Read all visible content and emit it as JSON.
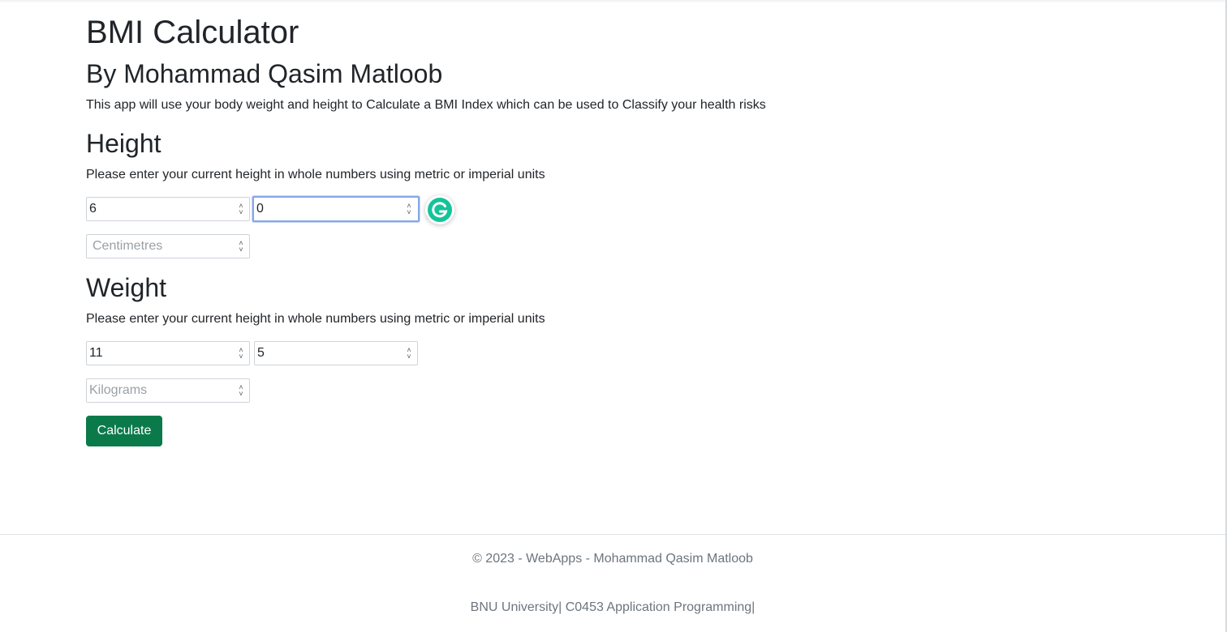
{
  "page": {
    "title": "BMI Calculator",
    "subtitle": "By Mohammad Qasim Matloob",
    "intro": "This app will use your body weight and height to Calculate a BMI Index which can be used to Classify your health risks"
  },
  "height": {
    "heading": "Height",
    "description": "Please enter your current height in whole numbers using metric or imperial units",
    "feet_value": "6",
    "inches_value": "0",
    "cm_placeholder": "Centimetres"
  },
  "weight": {
    "heading": "Weight",
    "description": "Please enter your current height in whole numbers using metric or imperial units",
    "stone_value": "11",
    "pounds_value": "5",
    "kg_placeholder": "Kilograms"
  },
  "actions": {
    "calculate_label": "Calculate"
  },
  "footer": {
    "copyright": "© 2023 - WebApps - Mohammad Qasim Matloob",
    "university": "BNU University| C0453 Application Programming|"
  },
  "colors": {
    "button_bg": "#0a7a4a",
    "focus_border": "#86a7e8",
    "grammarly": "#15c39a"
  },
  "icons": {
    "grammarly": "grammarly-g-icon",
    "spinner": "number-spinner-icon"
  }
}
